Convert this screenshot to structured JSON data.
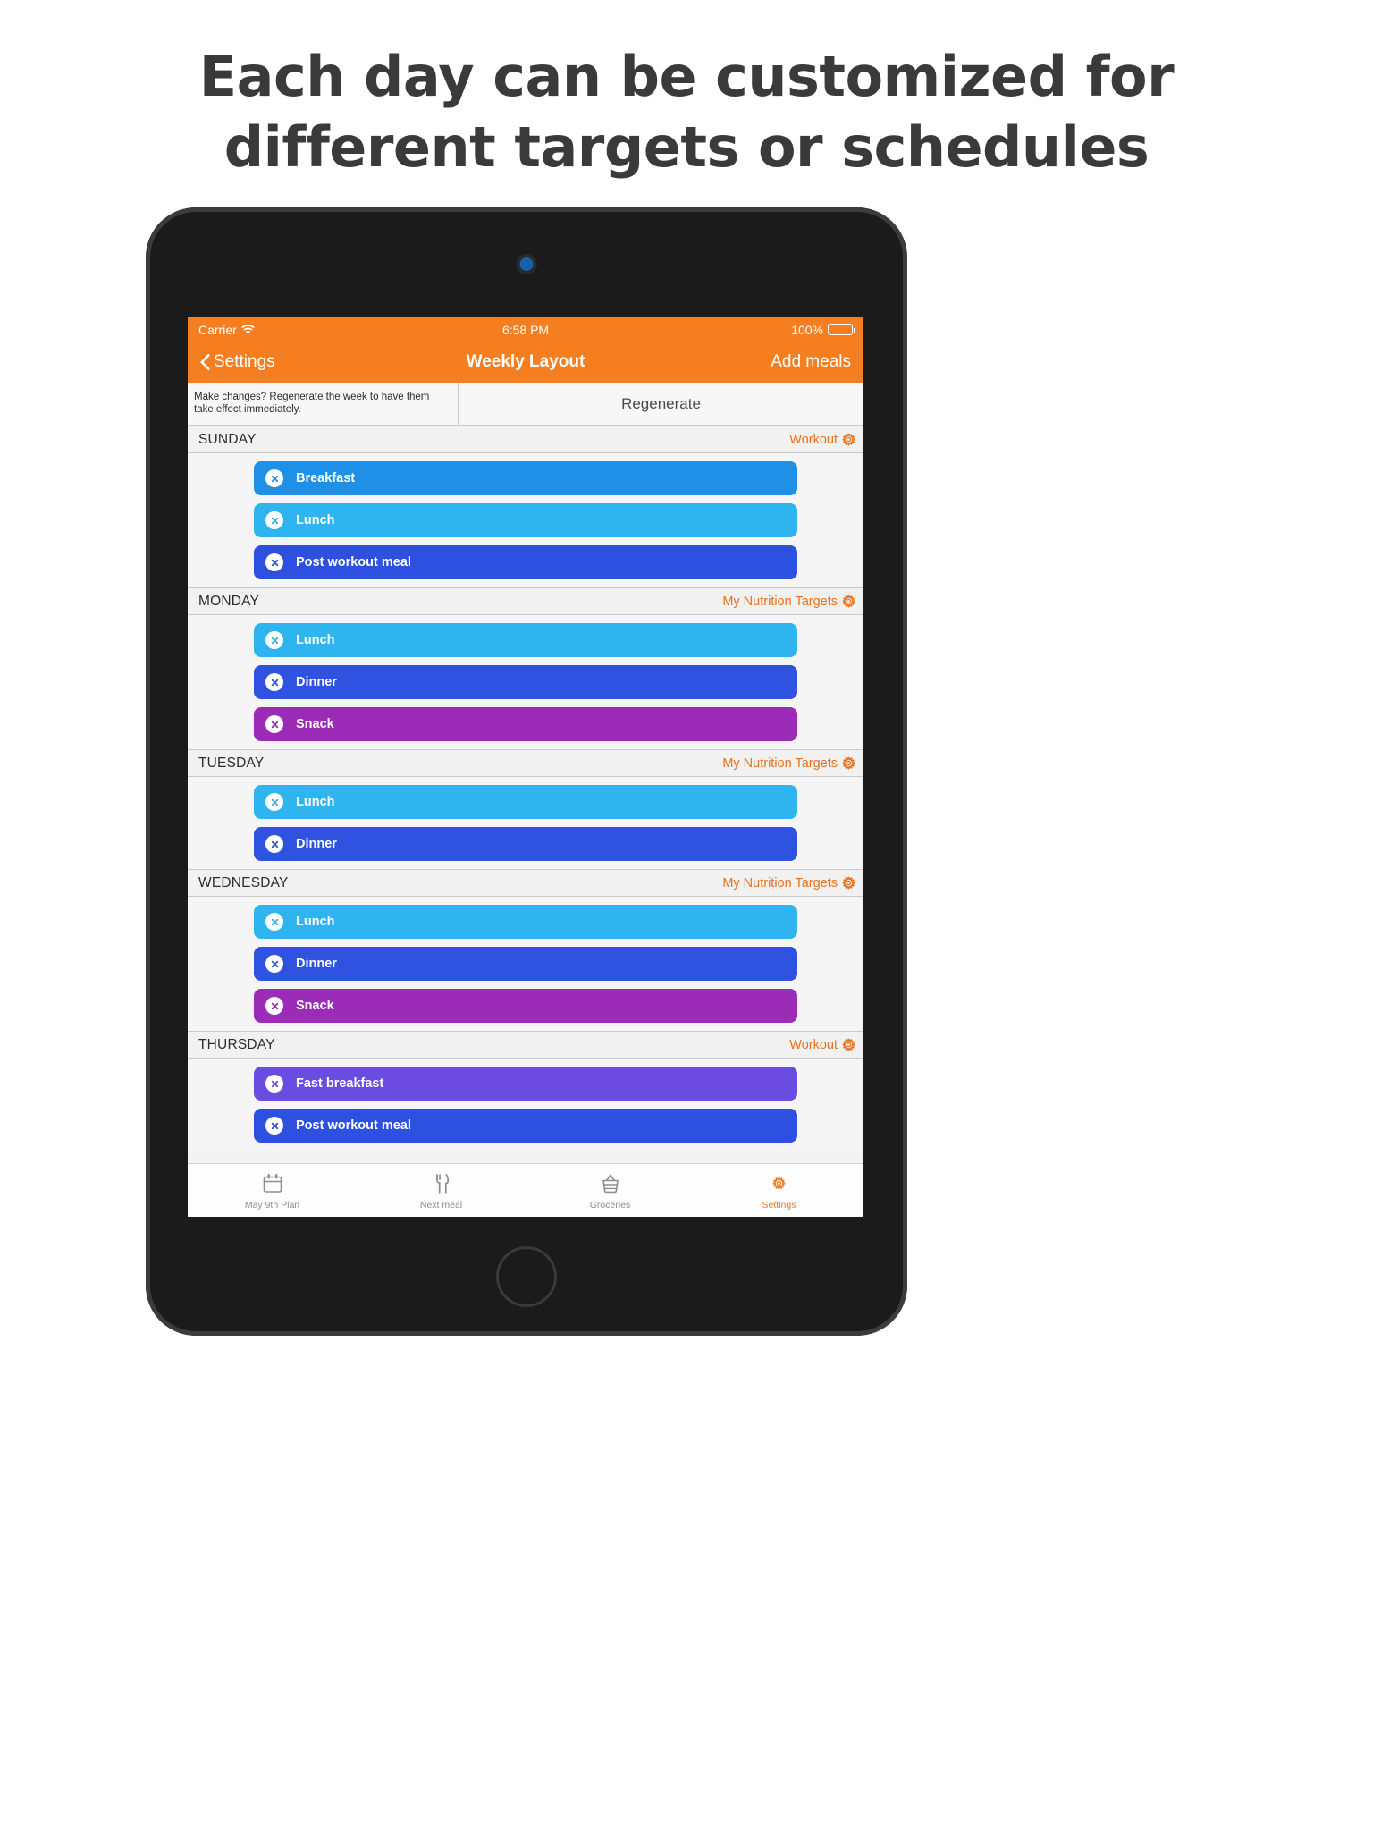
{
  "headline": "Each day can be customized for different targets or schedules",
  "status_bar": {
    "carrier": "Carrier",
    "wifi_icon": "wifi-icon",
    "time": "6:58 PM",
    "battery_percent": "100%",
    "battery_icon": "battery-full-icon"
  },
  "nav_bar": {
    "back_icon": "chevron-left-icon",
    "back_label": "Settings",
    "title": "Weekly Layout",
    "right_label": "Add meals"
  },
  "regenerate": {
    "message": "Make changes? Regenerate the week to have them take effect immediately.",
    "button_label": "Regenerate"
  },
  "colors": {
    "brand_orange": "#f57e20",
    "accent_orange": "#e8721c",
    "breakfast": "#1e90e8",
    "lunch": "#2eb5ef",
    "post_workout": "#2d50e0",
    "dinner": "#2f52e0",
    "snack": "#9c2bb8",
    "fast_breakfast": "#6a4ce0"
  },
  "days": [
    {
      "name": "SUNDAY",
      "tag": "Workout",
      "gear_icon": "gear-icon",
      "meals": [
        {
          "label": "Breakfast",
          "color": "#1e90e8",
          "remove_icon": "remove-circle-icon"
        },
        {
          "label": "Lunch",
          "color": "#2eb5ef",
          "remove_icon": "remove-circle-icon"
        },
        {
          "label": "Post workout meal",
          "color": "#2d50e0",
          "remove_icon": "remove-circle-icon"
        }
      ]
    },
    {
      "name": "MONDAY",
      "tag": "My Nutrition Targets",
      "gear_icon": "gear-icon",
      "meals": [
        {
          "label": "Lunch",
          "color": "#2eb5ef",
          "remove_icon": "remove-circle-icon"
        },
        {
          "label": "Dinner",
          "color": "#2f52e0",
          "remove_icon": "remove-circle-icon"
        },
        {
          "label": "Snack",
          "color": "#9c2bb8",
          "remove_icon": "remove-circle-icon"
        }
      ]
    },
    {
      "name": "TUESDAY",
      "tag": "My Nutrition Targets",
      "gear_icon": "gear-icon",
      "meals": [
        {
          "label": "Lunch",
          "color": "#2eb5ef",
          "remove_icon": "remove-circle-icon"
        },
        {
          "label": "Dinner",
          "color": "#2f52e0",
          "remove_icon": "remove-circle-icon"
        }
      ]
    },
    {
      "name": "WEDNESDAY",
      "tag": "My Nutrition Targets",
      "gear_icon": "gear-icon",
      "meals": [
        {
          "label": "Lunch",
          "color": "#2eb5ef",
          "remove_icon": "remove-circle-icon"
        },
        {
          "label": "Dinner",
          "color": "#2f52e0",
          "remove_icon": "remove-circle-icon"
        },
        {
          "label": "Snack",
          "color": "#9c2bb8",
          "remove_icon": "remove-circle-icon"
        }
      ]
    },
    {
      "name": "THURSDAY",
      "tag": "Workout",
      "gear_icon": "gear-icon",
      "meals": [
        {
          "label": "Fast breakfast",
          "color": "#6a4ce0",
          "remove_icon": "remove-circle-icon"
        },
        {
          "label": "Post workout meal",
          "color": "#2d50e0",
          "remove_icon": "remove-circle-icon"
        }
      ]
    }
  ],
  "tab_bar": [
    {
      "label": "May 9th Plan",
      "icon": "calendar-icon",
      "active": false
    },
    {
      "label": "Next meal",
      "icon": "fork-knife-icon",
      "active": false
    },
    {
      "label": "Groceries",
      "icon": "basket-icon",
      "active": false
    },
    {
      "label": "Settings",
      "icon": "gear-icon",
      "active": true
    }
  ]
}
